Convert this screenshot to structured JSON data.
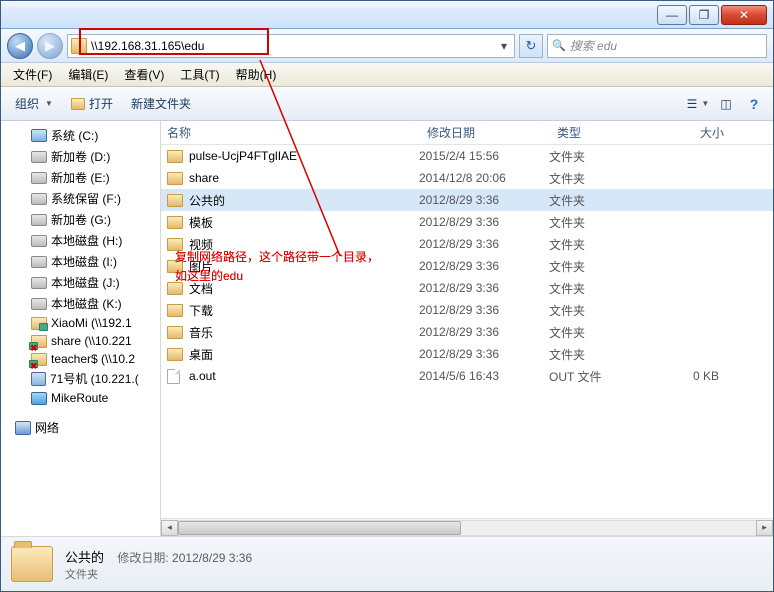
{
  "titlebar": {
    "min": "—",
    "max": "❐",
    "close": "✕"
  },
  "address": {
    "path": "\\\\192.168.31.165\\edu"
  },
  "search": {
    "placeholder": "搜索 edu"
  },
  "menubar": {
    "items": [
      "文件(F)",
      "编辑(E)",
      "查看(V)",
      "工具(T)",
      "帮助(H)"
    ]
  },
  "toolbar": {
    "organize": "组织",
    "open": "打开",
    "newfolder": "新建文件夹"
  },
  "sidebar": {
    "items": [
      {
        "icon": "sys",
        "label": "系统 (C:)"
      },
      {
        "icon": "drive",
        "label": "新加卷 (D:)"
      },
      {
        "icon": "drive",
        "label": "新加卷 (E:)"
      },
      {
        "icon": "drive",
        "label": "系统保留 (F:)"
      },
      {
        "icon": "drive",
        "label": "新加卷 (G:)"
      },
      {
        "icon": "drive",
        "label": "本地磁盘 (H:)"
      },
      {
        "icon": "drive",
        "label": "本地磁盘 (I:)"
      },
      {
        "icon": "drive",
        "label": "本地磁盘 (J:)"
      },
      {
        "icon": "drive",
        "label": "本地磁盘 (K:)"
      },
      {
        "icon": "netshare",
        "label": "XiaoMi (\\\\192.1"
      },
      {
        "icon": "netshare-x",
        "label": "share (\\\\10.221"
      },
      {
        "icon": "netshare-x",
        "label": "teacher$ (\\\\10.2"
      },
      {
        "icon": "comp",
        "label": "71号机 (10.221.("
      },
      {
        "icon": "router",
        "label": "MikeRoute"
      }
    ],
    "network_label": "网络"
  },
  "columns": {
    "name": "名称",
    "date": "修改日期",
    "type": "类型",
    "size": "大小"
  },
  "files": [
    {
      "name": "pulse-UcjP4FTglIAE",
      "date": "2015/2/4 15:56",
      "type": "文件夹",
      "size": "",
      "kind": "folder"
    },
    {
      "name": "share",
      "date": "2014/12/8 20:06",
      "type": "文件夹",
      "size": "",
      "kind": "folder"
    },
    {
      "name": "公共的",
      "date": "2012/8/29 3:36",
      "type": "文件夹",
      "size": "",
      "kind": "folder",
      "selected": true
    },
    {
      "name": "模板",
      "date": "2012/8/29 3:36",
      "type": "文件夹",
      "size": "",
      "kind": "folder"
    },
    {
      "name": "视频",
      "date": "2012/8/29 3:36",
      "type": "文件夹",
      "size": "",
      "kind": "folder"
    },
    {
      "name": "图片",
      "date": "2012/8/29 3:36",
      "type": "文件夹",
      "size": "",
      "kind": "folder"
    },
    {
      "name": "文档",
      "date": "2012/8/29 3:36",
      "type": "文件夹",
      "size": "",
      "kind": "folder"
    },
    {
      "name": "下载",
      "date": "2012/8/29 3:36",
      "type": "文件夹",
      "size": "",
      "kind": "folder"
    },
    {
      "name": "音乐",
      "date": "2012/8/29 3:36",
      "type": "文件夹",
      "size": "",
      "kind": "folder"
    },
    {
      "name": "桌面",
      "date": "2012/8/29 3:36",
      "type": "文件夹",
      "size": "",
      "kind": "folder"
    },
    {
      "name": "a.out",
      "date": "2014/5/6 16:43",
      "type": "OUT 文件",
      "size": "0 KB",
      "kind": "file"
    }
  ],
  "details": {
    "name": "公共的",
    "type_label": "文件夹",
    "date_label": "修改日期:",
    "date_value": "2012/8/29 3:36"
  },
  "annotation": {
    "line1": "复制网络路径，这个路径带一个目录，",
    "line2": "如这里的edu"
  }
}
